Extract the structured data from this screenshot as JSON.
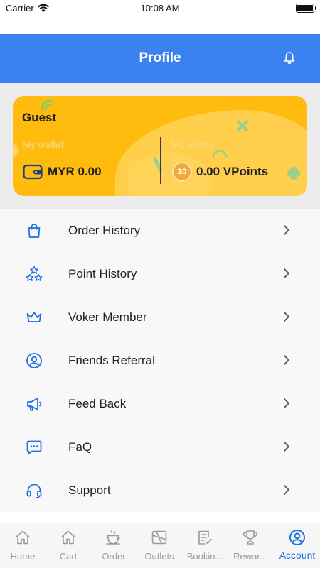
{
  "status_bar": {
    "carrier": "Carrier",
    "time": "10:08 AM"
  },
  "header": {
    "title": "Profile"
  },
  "card": {
    "name": "Guest",
    "wallet_label": "My wallet",
    "wallet_value": "MYR 0.00",
    "points_label": "My points",
    "coin_value": "10",
    "points_value": "0.00 VPoints"
  },
  "menu": {
    "items": [
      {
        "label": "Order History",
        "icon": "shopping-bag-icon"
      },
      {
        "label": "Point History",
        "icon": "stars-icon"
      },
      {
        "label": "Voker Member",
        "icon": "crown-icon"
      },
      {
        "label": "Friends Referral",
        "icon": "user-circle-icon"
      },
      {
        "label": "Feed Back",
        "icon": "megaphone-icon"
      },
      {
        "label": "FaQ",
        "icon": "chat-bubble-icon"
      },
      {
        "label": "Support",
        "icon": "headset-icon"
      }
    ]
  },
  "tabbar": {
    "tabs": [
      {
        "label": "Home",
        "icon": "home-icon"
      },
      {
        "label": "Cart",
        "icon": "home-icon"
      },
      {
        "label": "Order",
        "icon": "coffee-cup-icon"
      },
      {
        "label": "Outlets",
        "icon": "map-icon"
      },
      {
        "label": "Bookin...",
        "icon": "document-check-icon"
      },
      {
        "label": "Rewar...",
        "icon": "trophy-icon"
      },
      {
        "label": "Account",
        "icon": "account-circle-icon"
      }
    ],
    "active_index": 6
  },
  "colors": {
    "primary": "#3b82f0",
    "card": "#ffbb0e",
    "accent_blue": "#1f6fe5",
    "inactive_tab": "#9a9a9a"
  }
}
